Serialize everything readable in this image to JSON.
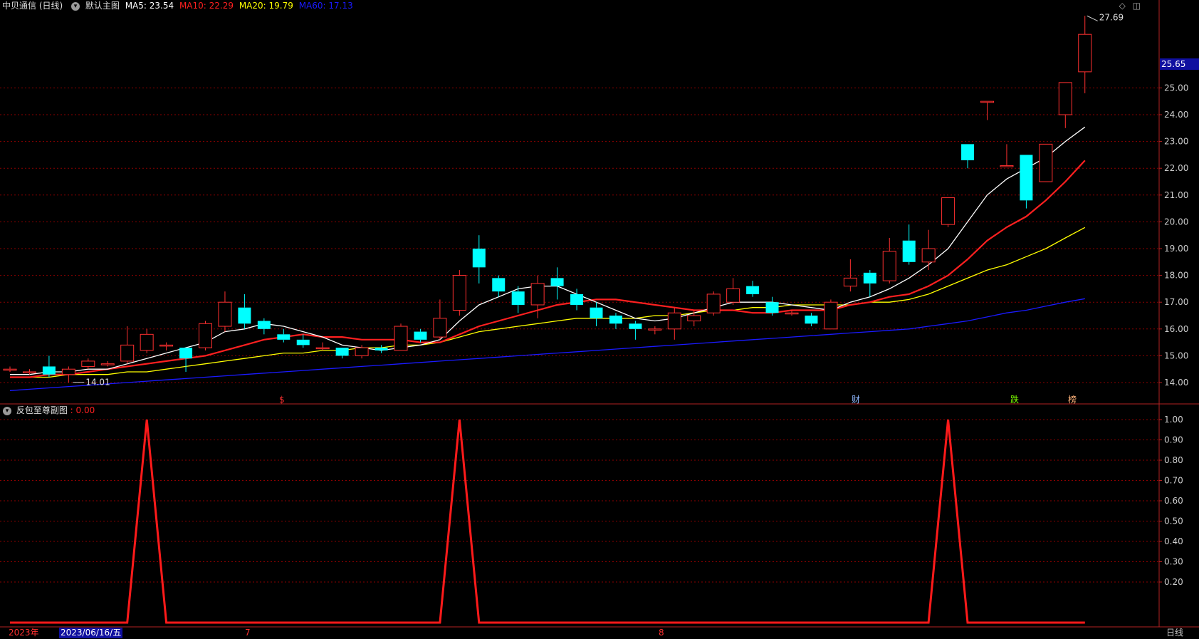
{
  "header": {
    "title": "中贝通信 (日线)",
    "template": "默认主图",
    "ma5": "MA5: 23.54",
    "ma10": "MA10: 22.29",
    "ma20": "MA20: 19.79",
    "ma60": "MA60: 17.13",
    "icons": [
      "diamond-icon",
      "window-toggle-icon"
    ]
  },
  "colors": {
    "up": "#ff3030",
    "down": "#00ffff",
    "ma5": "#ffffff",
    "ma10": "#ff2020",
    "ma20": "#ffff00",
    "ma60": "#1a1aff",
    "grid": "#8b0000",
    "axis": "#b22222"
  },
  "main_axis": {
    "ticks": [
      "14.00",
      "15.00",
      "16.00",
      "17.00",
      "18.00",
      "19.00",
      "20.00",
      "21.00",
      "22.00",
      "23.00",
      "24.00",
      "25.00"
    ],
    "current_price": "25.65",
    "high_label": "27.69",
    "low_label": "14.01"
  },
  "markers": [
    "$",
    "财",
    "跌",
    "榜"
  ],
  "sub_chart": {
    "title": "反包至尊副图",
    "value": ": 0.00",
    "ticks": [
      "0.20",
      "0.30",
      "0.40",
      "0.50",
      "0.60",
      "0.70",
      "0.80",
      "0.90",
      "1.00"
    ]
  },
  "bottom": {
    "year": "2023年",
    "date": "2023/06/16/五",
    "months": [
      "7",
      "8"
    ],
    "period": "日线"
  },
  "chart_data": {
    "type": "candlestick",
    "candles": [
      [
        14.5,
        14.5,
        14.6,
        14.4
      ],
      [
        14.4,
        14.4,
        14.5,
        14.3
      ],
      [
        14.6,
        14.3,
        15.0,
        14.2
      ],
      [
        14.3,
        14.5,
        14.6,
        14.0
      ],
      [
        14.6,
        14.8,
        14.9,
        14.5
      ],
      [
        14.7,
        14.7,
        14.8,
        14.6
      ],
      [
        14.8,
        15.4,
        16.1,
        14.7
      ],
      [
        15.2,
        15.8,
        16.0,
        15.1
      ],
      [
        15.4,
        15.4,
        15.5,
        15.2
      ],
      [
        15.3,
        14.9,
        15.3,
        14.4
      ],
      [
        15.3,
        16.2,
        16.3,
        15.2
      ],
      [
        16.1,
        17.0,
        17.4,
        15.9
      ],
      [
        16.8,
        16.2,
        17.3,
        16.0
      ],
      [
        16.3,
        16.0,
        16.4,
        15.8
      ],
      [
        15.8,
        15.6,
        16.0,
        15.5
      ],
      [
        15.6,
        15.4,
        15.8,
        15.3
      ],
      [
        15.3,
        15.3,
        15.5,
        15.2
      ],
      [
        15.3,
        15.0,
        15.3,
        14.9
      ],
      [
        15.0,
        15.3,
        15.4,
        14.9
      ],
      [
        15.3,
        15.2,
        15.4,
        15.1
      ],
      [
        15.2,
        16.1,
        16.2,
        15.2
      ],
      [
        15.9,
        15.6,
        16.0,
        15.5
      ],
      [
        15.7,
        16.4,
        17.1,
        15.6
      ],
      [
        16.7,
        18.0,
        18.2,
        16.5
      ],
      [
        19.0,
        18.3,
        19.5,
        17.7
      ],
      [
        17.9,
        17.4,
        18.0,
        17.2
      ],
      [
        17.4,
        16.9,
        17.6,
        16.6
      ],
      [
        16.9,
        17.7,
        18.0,
        16.4
      ],
      [
        17.9,
        17.6,
        18.3,
        17.1
      ],
      [
        17.3,
        16.9,
        17.5,
        16.7
      ],
      [
        16.8,
        16.4,
        17.0,
        16.1
      ],
      [
        16.5,
        16.2,
        16.6,
        16.0
      ],
      [
        16.2,
        16.0,
        16.3,
        15.6
      ],
      [
        16.0,
        16.0,
        16.1,
        15.8
      ],
      [
        16.0,
        16.6,
        16.8,
        15.6
      ],
      [
        16.3,
        16.5,
        16.7,
        16.1
      ],
      [
        16.6,
        17.3,
        17.4,
        16.5
      ],
      [
        17.0,
        17.5,
        17.9,
        16.9
      ],
      [
        17.6,
        17.3,
        17.8,
        17.2
      ],
      [
        17.0,
        16.6,
        17.2,
        16.5
      ],
      [
        16.6,
        16.6,
        16.7,
        16.5
      ],
      [
        16.5,
        16.2,
        16.6,
        16.1
      ],
      [
        16.0,
        17.0,
        17.1,
        16.0
      ],
      [
        17.6,
        17.9,
        18.6,
        17.4
      ],
      [
        18.1,
        17.7,
        18.2,
        17.2
      ],
      [
        17.8,
        18.9,
        19.4,
        17.7
      ],
      [
        19.3,
        18.5,
        19.9,
        18.4
      ],
      [
        18.5,
        19.0,
        19.7,
        18.2
      ],
      [
        19.9,
        20.9,
        20.9,
        19.8
      ],
      [
        22.9,
        22.3,
        22.9,
        22.0
      ],
      [
        24.5,
        24.5,
        24.5,
        23.8
      ],
      [
        22.1,
        22.1,
        22.9,
        22.1
      ],
      [
        22.5,
        20.8,
        22.5,
        20.5
      ],
      [
        21.5,
        22.9,
        22.9,
        21.5
      ],
      [
        24.0,
        25.2,
        25.2,
        23.5
      ],
      [
        25.6,
        27.0,
        27.69,
        24.8
      ]
    ],
    "ma5": [
      14.3,
      14.3,
      14.4,
      14.4,
      14.5,
      14.5,
      14.7,
      14.9,
      15.1,
      15.3,
      15.5,
      15.9,
      16.0,
      16.2,
      16.1,
      15.9,
      15.7,
      15.4,
      15.3,
      15.2,
      15.3,
      15.4,
      15.6,
      16.3,
      16.9,
      17.2,
      17.5,
      17.6,
      17.6,
      17.3,
      17.0,
      16.7,
      16.4,
      16.3,
      16.4,
      16.6,
      16.8,
      17.0,
      17.0,
      17.0,
      16.9,
      16.8,
      16.7,
      17.0,
      17.2,
      17.5,
      17.9,
      18.4,
      19.0,
      20.0,
      21.0,
      21.6,
      22.0,
      22.4,
      23.0,
      23.54
    ],
    "ma10": [
      14.2,
      14.2,
      14.3,
      14.3,
      14.4,
      14.5,
      14.6,
      14.7,
      14.8,
      14.9,
      15.0,
      15.2,
      15.4,
      15.6,
      15.7,
      15.8,
      15.7,
      15.7,
      15.6,
      15.6,
      15.6,
      15.5,
      15.5,
      15.8,
      16.1,
      16.3,
      16.5,
      16.7,
      16.9,
      17.0,
      17.1,
      17.1,
      17.0,
      16.9,
      16.8,
      16.7,
      16.7,
      16.7,
      16.6,
      16.6,
      16.7,
      16.7,
      16.7,
      16.9,
      17.0,
      17.2,
      17.3,
      17.6,
      18.0,
      18.6,
      19.3,
      19.8,
      20.2,
      20.8,
      21.5,
      22.29
    ],
    "ma20": [
      14.2,
      14.2,
      14.2,
      14.3,
      14.3,
      14.3,
      14.4,
      14.4,
      14.5,
      14.6,
      14.7,
      14.8,
      14.9,
      15.0,
      15.1,
      15.1,
      15.2,
      15.2,
      15.3,
      15.3,
      15.4,
      15.4,
      15.5,
      15.7,
      15.9,
      16.0,
      16.1,
      16.2,
      16.3,
      16.4,
      16.4,
      16.4,
      16.4,
      16.5,
      16.5,
      16.6,
      16.7,
      16.7,
      16.8,
      16.8,
      16.9,
      16.9,
      16.9,
      16.9,
      17.0,
      17.0,
      17.1,
      17.3,
      17.6,
      17.9,
      18.2,
      18.4,
      18.7,
      19.0,
      19.4,
      19.79
    ],
    "ma60": [
      13.7,
      13.75,
      13.8,
      13.85,
      13.9,
      13.95,
      14.0,
      14.05,
      14.1,
      14.15,
      14.2,
      14.25,
      14.3,
      14.35,
      14.4,
      14.45,
      14.5,
      14.55,
      14.6,
      14.65,
      14.7,
      14.75,
      14.8,
      14.85,
      14.9,
      14.95,
      15.0,
      15.05,
      15.1,
      15.15,
      15.2,
      15.25,
      15.3,
      15.35,
      15.4,
      15.45,
      15.5,
      15.55,
      15.6,
      15.65,
      15.7,
      15.75,
      15.8,
      15.85,
      15.9,
      15.95,
      16.0,
      16.1,
      16.2,
      16.3,
      16.45,
      16.6,
      16.7,
      16.85,
      17.0,
      17.13
    ],
    "sub_signal_peaks": [
      7,
      23,
      48
    ],
    "ylim_main": [
      13.5,
      28.2
    ],
    "ylim_sub": [
      0,
      1.05
    ]
  }
}
